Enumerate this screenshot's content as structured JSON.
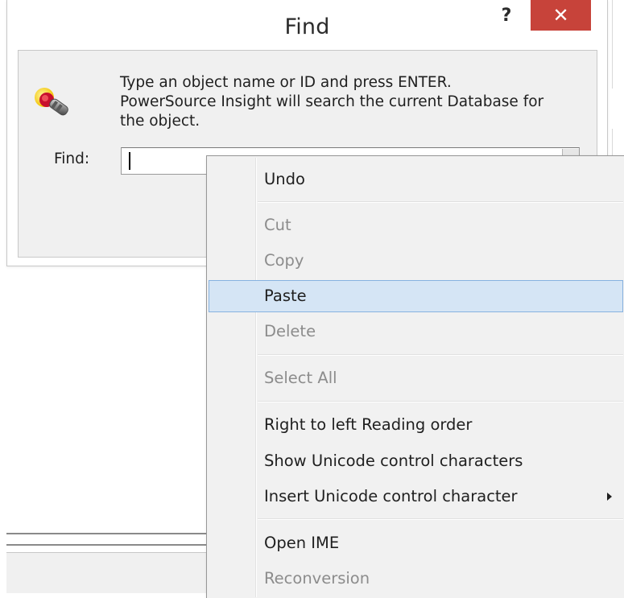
{
  "dialog": {
    "title": "Find",
    "help_label": "?",
    "close_label": "✕",
    "instruction_line1": "Type an object name or ID and press ENTER.",
    "instruction_line2": "PowerSource Insight will search the current Database for",
    "instruction_line3": "the object.",
    "find_label": "Find:",
    "find_value": "",
    "app_icon": "magnifier-icon"
  },
  "context_menu": {
    "items": [
      {
        "label": "Undo",
        "enabled": true
      },
      {
        "label": "Cut",
        "enabled": false
      },
      {
        "label": "Copy",
        "enabled": false
      },
      {
        "label": "Paste",
        "enabled": true,
        "highlighted": true
      },
      {
        "label": "Delete",
        "enabled": false
      },
      {
        "label": "Select All",
        "enabled": false
      },
      {
        "label": "Right to left Reading order",
        "enabled": true
      },
      {
        "label": "Show Unicode control characters",
        "enabled": true
      },
      {
        "label": "Insert Unicode control character",
        "enabled": true,
        "submenu": true
      },
      {
        "label": "Open IME",
        "enabled": true
      },
      {
        "label": "Reconversion",
        "enabled": false
      }
    ]
  },
  "colors": {
    "close_button": "#c7433a",
    "menu_highlight": "#d5e5f5",
    "menu_highlight_border": "#87b2e0",
    "disabled_text": "#8c8c8c"
  }
}
